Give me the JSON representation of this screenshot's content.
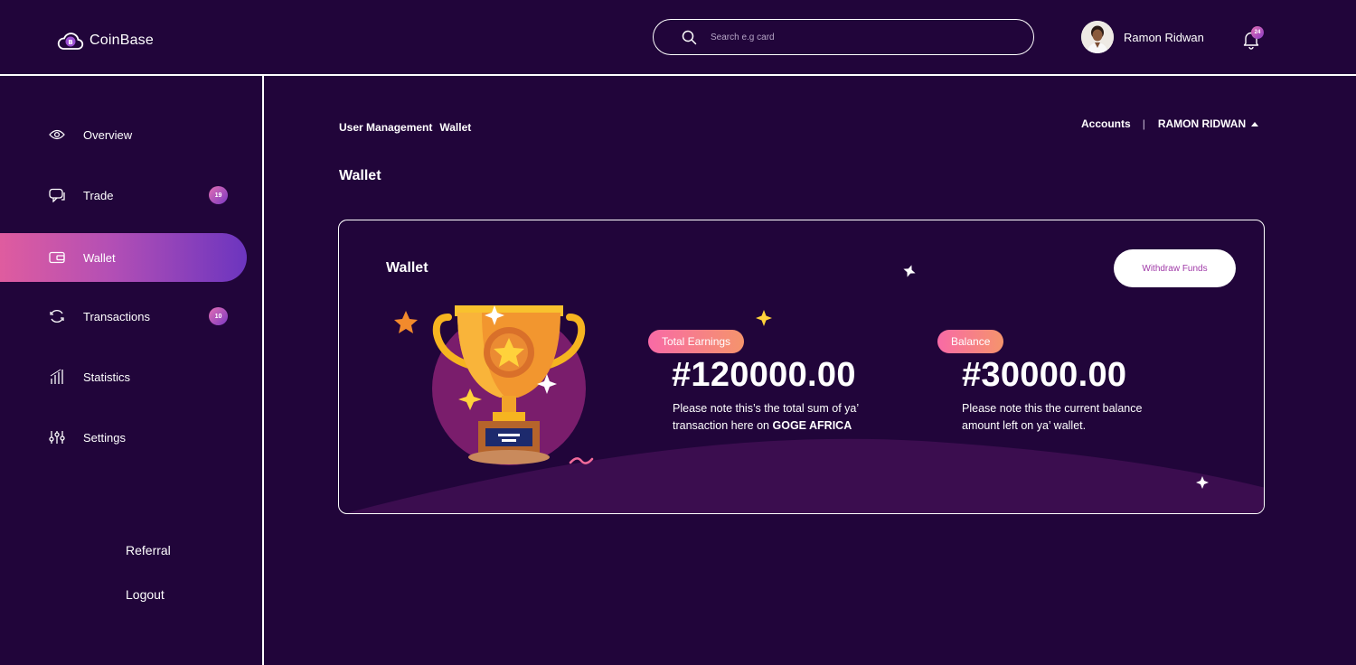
{
  "header": {
    "logo_text": "CoinBase",
    "search_placeholder": "Search e.g card",
    "user_name": "Ramon Ridwan",
    "notification_count": "24"
  },
  "sidebar": {
    "items": [
      {
        "label": "Overview",
        "icon": "eye-icon"
      },
      {
        "label": "Trade",
        "icon": "chat-icon",
        "badge": "19"
      },
      {
        "label": "Wallet",
        "icon": "wallet-icon",
        "active": true
      },
      {
        "label": "Transactions",
        "icon": "refresh-icon",
        "badge": "10"
      },
      {
        "label": "Statistics",
        "icon": "bar-chart-icon"
      },
      {
        "label": "Settings",
        "icon": "sliders-icon"
      }
    ],
    "referral": "Referral",
    "logout": "Logout"
  },
  "breadcrumb": {
    "parent": "User Management",
    "current": "Wallet"
  },
  "account_menu": {
    "accounts": "Accounts",
    "user": "RAMON RIDWAN"
  },
  "page_title": "Wallet",
  "wallet_card": {
    "title": "Wallet",
    "withdraw_label": "Withdraw Funds",
    "total_earnings": {
      "label": "Total Earnings",
      "amount": "#120000.00",
      "note_prefix": "Please note this’s the total sum of ya’ transaction here on ",
      "note_bold": "GOGE AFRICA"
    },
    "balance": {
      "label": "Balance",
      "amount": "#30000.00",
      "note": "Please note this the current balance amount left on ya’ wallet."
    }
  },
  "colors": {
    "background": "#21053a",
    "accent_pink": "#df5c9f",
    "accent_purple": "#6c35bf",
    "pill_gradient_start": "#f86aa6",
    "pill_gradient_end": "#f5946c"
  }
}
